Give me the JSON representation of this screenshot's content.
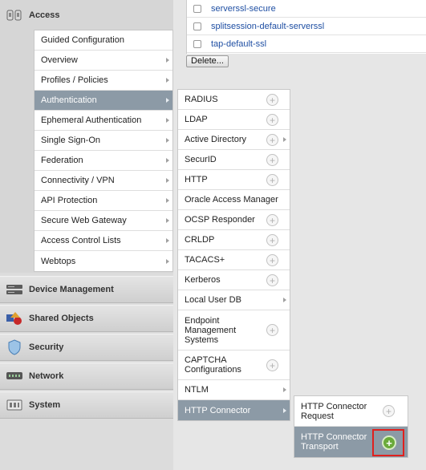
{
  "nav": {
    "access_label": "Access",
    "sections": [
      {
        "label": "Device Management",
        "icon": "device-management-icon"
      },
      {
        "label": "Shared Objects",
        "icon": "shared-objects-icon"
      },
      {
        "label": "Security",
        "icon": "shield-icon"
      },
      {
        "label": "Network",
        "icon": "network-icon"
      },
      {
        "label": "System",
        "icon": "system-icon"
      }
    ]
  },
  "table": {
    "rows": [
      "serverssl-secure",
      "splitsession-default-serverssl",
      "tap-default-ssl"
    ],
    "delete_label": "Delete..."
  },
  "access_menu": {
    "items": [
      {
        "label": "Guided Configuration",
        "has_sub": false
      },
      {
        "label": "Overview",
        "has_sub": true
      },
      {
        "label": "Profiles / Policies",
        "has_sub": true
      },
      {
        "label": "Authentication",
        "has_sub": true,
        "active": true
      },
      {
        "label": "Ephemeral Authentication",
        "has_sub": true
      },
      {
        "label": "Single Sign-On",
        "has_sub": true
      },
      {
        "label": "Federation",
        "has_sub": true
      },
      {
        "label": "Connectivity / VPN",
        "has_sub": true
      },
      {
        "label": "API Protection",
        "has_sub": true
      },
      {
        "label": "Secure Web Gateway",
        "has_sub": true
      },
      {
        "label": "Access Control Lists",
        "has_sub": true
      },
      {
        "label": "Webtops",
        "has_sub": true
      }
    ]
  },
  "auth_menu": {
    "items": [
      {
        "label": "RADIUS",
        "plus": true
      },
      {
        "label": "LDAP",
        "plus": true
      },
      {
        "label": "Active Directory",
        "plus": true,
        "has_sub": true
      },
      {
        "label": "SecurID",
        "plus": true
      },
      {
        "label": "HTTP",
        "plus": true
      },
      {
        "label": "Oracle Access Manager"
      },
      {
        "label": "OCSP Responder",
        "plus": true
      },
      {
        "label": "CRLDP",
        "plus": true
      },
      {
        "label": "TACACS+",
        "plus": true
      },
      {
        "label": "Kerberos",
        "plus": true
      },
      {
        "label": "Local User DB",
        "has_sub": true
      },
      {
        "label": "Endpoint Management Systems",
        "lines": [
          "Endpoint",
          "Management",
          "Systems"
        ],
        "plus": true
      },
      {
        "label": "CAPTCHA Configurations",
        "lines": [
          "CAPTCHA",
          "Configurations"
        ],
        "plus": true
      },
      {
        "label": "NTLM",
        "has_sub": true
      },
      {
        "label": "HTTP Connector",
        "has_sub": true,
        "active": true
      }
    ]
  },
  "connector_menu": {
    "items": [
      {
        "lines": [
          "HTTP Connector",
          "Request"
        ],
        "plus": true
      },
      {
        "lines": [
          "HTTP Connector",
          "Transport"
        ],
        "plus": true,
        "active": true,
        "highlight": true
      }
    ]
  },
  "colors": {
    "active_row": "#8c9aa6",
    "link": "#1f4fa3",
    "highlight": "#e0201e",
    "create_green": "#6aaa3a"
  }
}
